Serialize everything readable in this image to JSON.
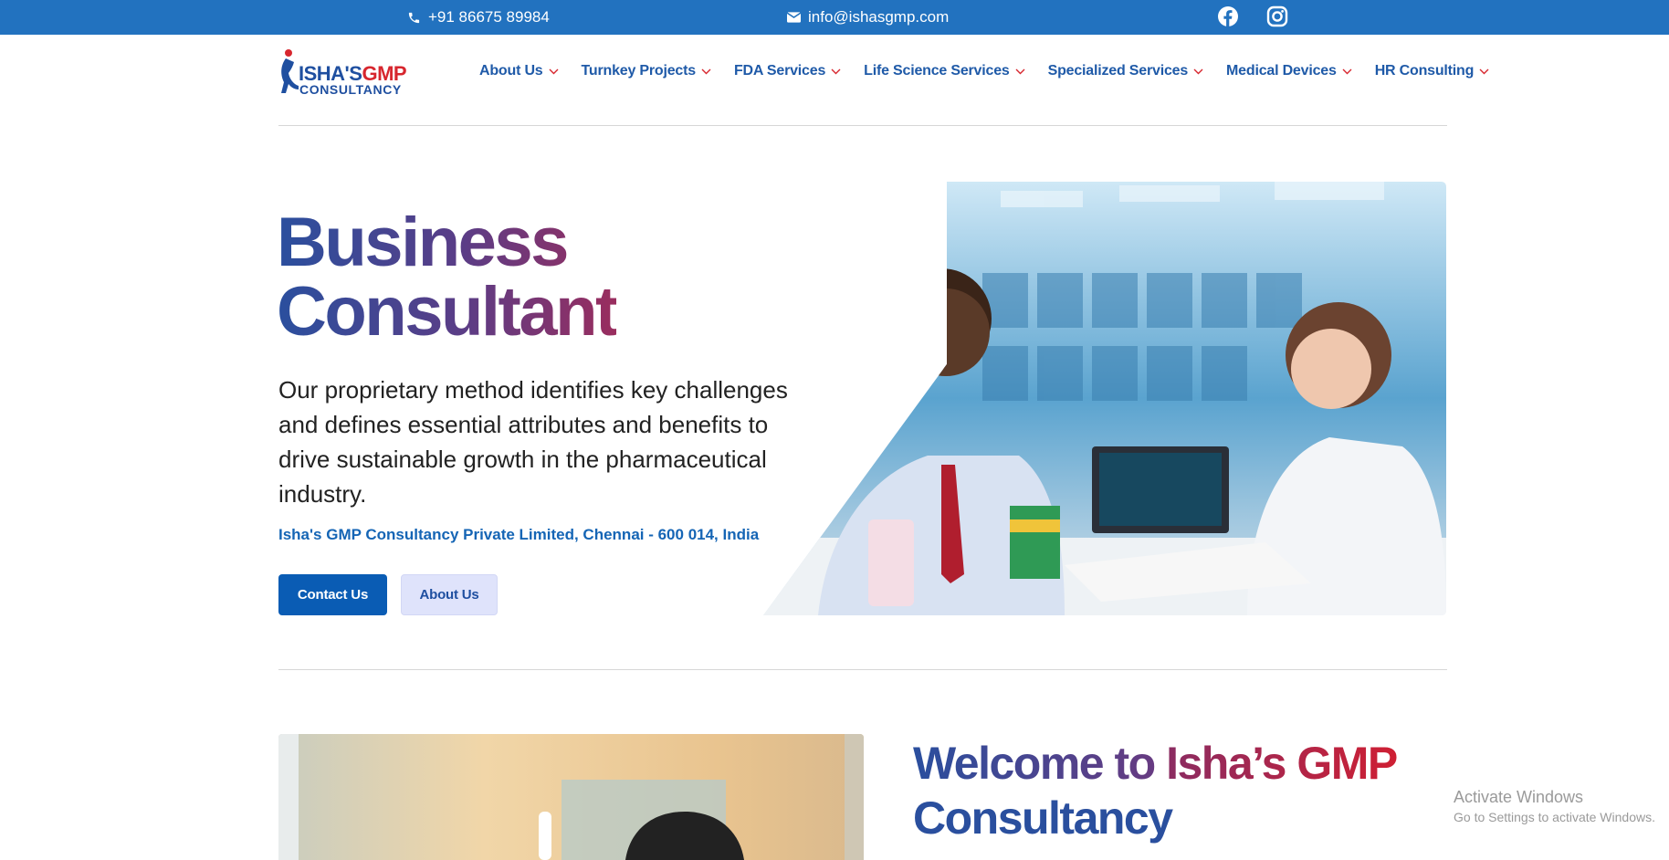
{
  "topbar": {
    "phone": "+91 86675 89984",
    "email": "info@ishasgmp.com",
    "social": [
      "facebook-icon",
      "instagram-icon"
    ],
    "color": "#2272bf"
  },
  "logo": {
    "line1_a": "ISHA'S",
    "line1_b": "GMP",
    "line2": "CONSULTANCY"
  },
  "nav": {
    "items": [
      {
        "label": "About Us"
      },
      {
        "label": "Turnkey Projects"
      },
      {
        "label": "FDA Services"
      },
      {
        "label": "Life Science Services"
      },
      {
        "label": "Specialized Services"
      },
      {
        "label": "Medical Devices"
      },
      {
        "label": "HR Consulting"
      }
    ]
  },
  "hero": {
    "title_line1": "Business",
    "title_line2": "Consultant",
    "description": "Our proprietary method identifies key challenges and defines essential attributes and benefits to drive sustainable growth in the pharmaceutical industry.",
    "address": "Isha's GMP Consultancy Private Limited, Chennai - 600 014, India",
    "contact_button": "Contact Us",
    "about_button": "About Us"
  },
  "welcome": {
    "title_part1": "Welcome to ",
    "title_part2": "Isha’s GMP",
    "title_part3": "Consultancy"
  },
  "os_watermark": {
    "line1": "Activate Windows",
    "line2": "Go to Settings to activate Windows."
  },
  "colors": {
    "brand_blue": "#1f4fa0",
    "brand_red": "#d7262e",
    "button_primary": "#0a5cb4",
    "button_secondary": "#dfe3fb"
  }
}
